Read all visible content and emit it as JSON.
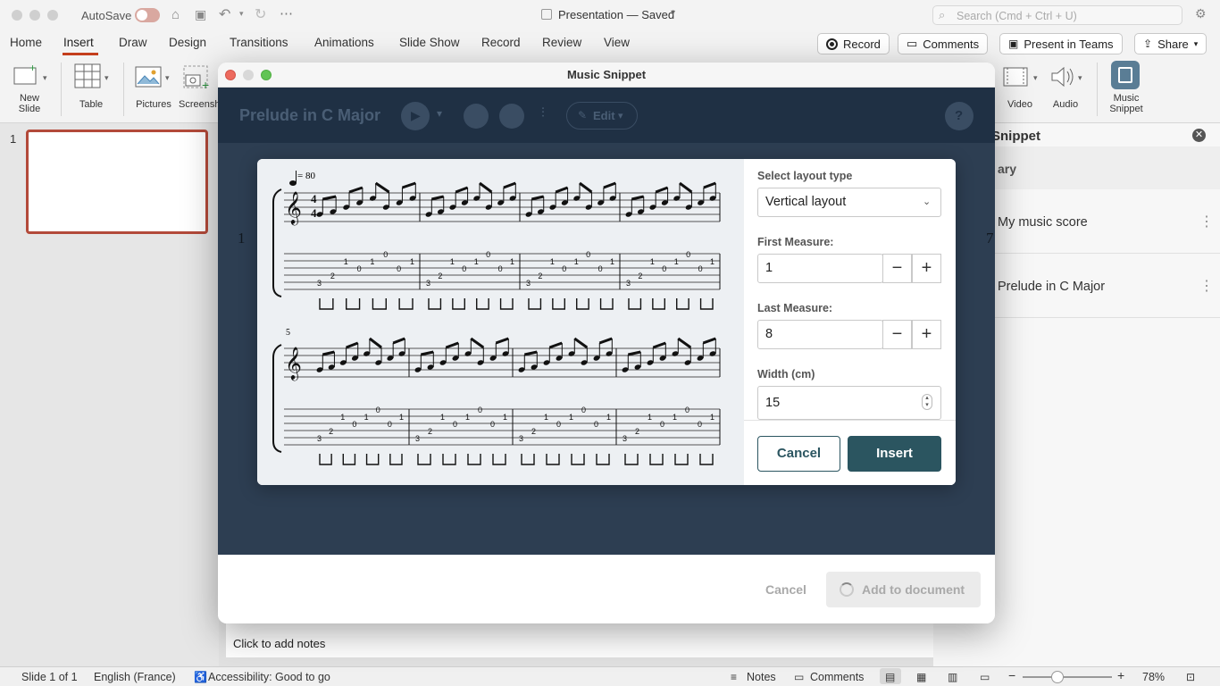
{
  "titlebar": {
    "autosave_label": "AutoSave",
    "document_title": "Presentation — Saved",
    "search_placeholder": "Search (Cmd + Ctrl + U)"
  },
  "ribbon_tabs": [
    "Home",
    "Insert",
    "Draw",
    "Design",
    "Transitions",
    "Animations",
    "Slide Show",
    "Record",
    "Review",
    "View"
  ],
  "active_tab": "Insert",
  "accent_color": "#c43e1c",
  "header_buttons": {
    "record": "Record",
    "comments": "Comments",
    "present": "Present in Teams",
    "share": "Share"
  },
  "ribbon": {
    "new_slide": [
      "New",
      "Slide"
    ],
    "table": "Table",
    "pictures": "Pictures",
    "screenshot": "Screenshot",
    "video": "Video",
    "audio": "Audio",
    "music_snippet": [
      "Music",
      "Snippet"
    ]
  },
  "thumbnail": {
    "number": "1"
  },
  "notes_placeholder": "Click to add notes",
  "right_pane": {
    "title": "Snippet",
    "section": "ary",
    "items": [
      "My music score",
      "Prelude in C Major"
    ]
  },
  "dialog": {
    "title": "Music Snippet",
    "toolbar": {
      "score_title": "Prelude in C Major",
      "edit_label": "Edit"
    },
    "background_numbers": {
      "left": "1",
      "right": "7"
    },
    "footer": {
      "cancel": "Cancel",
      "add": "Add to document"
    }
  },
  "insert_popup": {
    "tempo": "= 80",
    "system2_measure": "5",
    "layout_label": "Select layout type",
    "layout_value": "Vertical layout",
    "first_label": "First Measure:",
    "first_value": "1",
    "last_label": "Last Measure:",
    "last_value": "8",
    "width_label": "Width (cm)",
    "width_value": "15",
    "cancel": "Cancel",
    "insert": "Insert"
  },
  "tab_numbers": {
    "system1": [
      {
        "s1": [
          "0",
          "0"
        ],
        "s2": [
          "1",
          "1"
        ],
        "s3": [
          "0",
          "0"
        ],
        "s4": [
          "2"
        ],
        "s5": [
          "3"
        ]
      },
      {
        "s1": [
          "0"
        ],
        "s2": [
          "1",
          "1"
        ],
        "s3": [
          "0",
          "0"
        ],
        "s4": [
          "2"
        ],
        "s5": [
          "3"
        ]
      },
      {
        "s1": [],
        "s2": [
          "1",
          "1"
        ],
        "s3": [
          "3",
          "3"
        ],
        "s4": [
          "2",
          "2"
        ],
        "s5": [
          "0"
        ]
      },
      {
        "s1": [],
        "s2": [
          "1",
          "1"
        ],
        "s3": [
          "3",
          "3"
        ],
        "s4": [
          "2",
          "2"
        ],
        "s5": [
          "0"
        ]
      }
    ]
  },
  "status": {
    "slide": "Slide 1 of 1",
    "language": "English (France)",
    "accessibility": "Accessibility: Good to go",
    "notes": "Notes",
    "comments": "Comments",
    "zoom": "78%"
  }
}
